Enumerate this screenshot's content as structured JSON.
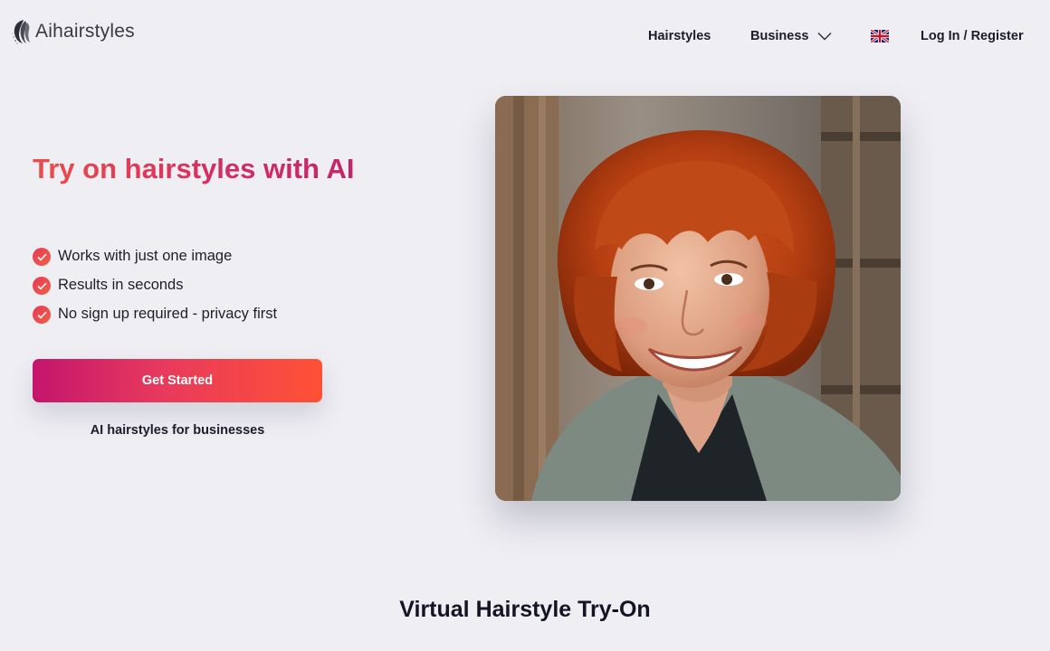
{
  "header": {
    "logo_text": "Aihairstyles",
    "logo_icon": "hair-strands-icon",
    "nav": {
      "hairstyles": "Hairstyles",
      "business": "Business",
      "language_icon": "uk-flag-icon",
      "login": "Log In / Register"
    }
  },
  "hero": {
    "title": "Try on hairstyles with AI",
    "features": [
      "Works with just one image",
      "Results in seconds",
      "No sign up required - privacy first"
    ],
    "cta_label": "Get Started",
    "business_link": "AI hairstyles for businesses",
    "photo_alt": "Smiling woman with a red bob haircut and bangs"
  },
  "section": {
    "title": "Virtual Hairstyle Try-On"
  },
  "colors": {
    "background": "#eeeef3",
    "gradient_start": "#c4156d",
    "gradient_end": "#ff5135",
    "text": "#1c1c2b"
  }
}
